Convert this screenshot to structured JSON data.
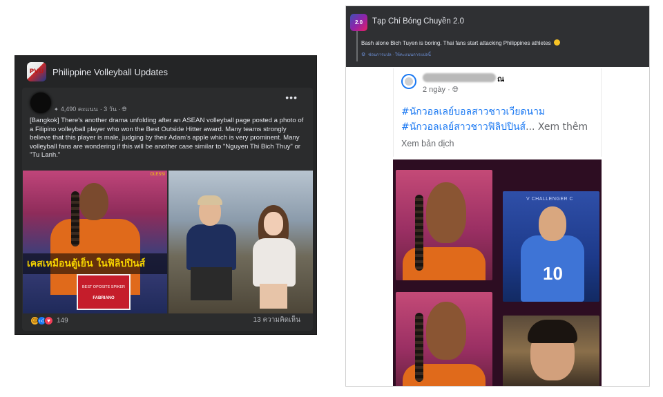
{
  "left_post": {
    "page_name": "Philippine Volleyball Updates",
    "logo_text": "PVU",
    "meta": {
      "followers": "4,490 คะแนน",
      "time": "· 3 วัน ·",
      "privacy_icon": "globe-icon"
    },
    "menu_label": "•••",
    "text": "[Bangkok] There's another drama unfolding after an ASEAN volleyball page posted a photo of a Filipino volleyball player who won the Best Outside Hitter award. Many teams strongly believe that this player is male, judging by their Adam's apple which is very prominent. Many volleyball fans are wondering if this will be another case similar to \"Nguyen Thi Bich Thuy\" or \"Tu Lanh.\"",
    "image_caption": "เคสเหมือนตู้เย็น ในฟิลิปปินส์",
    "award_text": "BEST OPOSITE SPIKER",
    "award_brand": "FABRIANO",
    "corner_logo": "OLESSI",
    "reaction_count": "149",
    "comments": "13 ความคิดเห็น"
  },
  "right_post": {
    "page_name": "Tạp Chí Bóng Chuyền 2.0",
    "logo_text": "2.0",
    "caption": "Bash alone Bich Tuyen is boring. Thai fans start attacking Philippines athletes",
    "translate_links": "ซ่อนการแปล · ให้คะแนนการแปลนี้",
    "shared": {
      "name_tail": "ณ",
      "time": "2 ngày · ",
      "hashtag1": "#นักวอลเลย์บอลสาวชาวเวียดนาม",
      "hashtag2": "#นักวอลเลย์สาวชาวฟิลิปปินส์",
      "see_more": "... Xem thêm",
      "see_translation": "Xem bản dịch"
    },
    "jersey_number": "10",
    "banner_text": "V CHALLENGER C"
  },
  "colors": {
    "fb_dark_bg": "#242526",
    "fb_text": "#e4e6eb",
    "fb_blue": "#1877f2",
    "caption_yellow": "#f6d300",
    "jersey_orange": "#e06a1b"
  }
}
